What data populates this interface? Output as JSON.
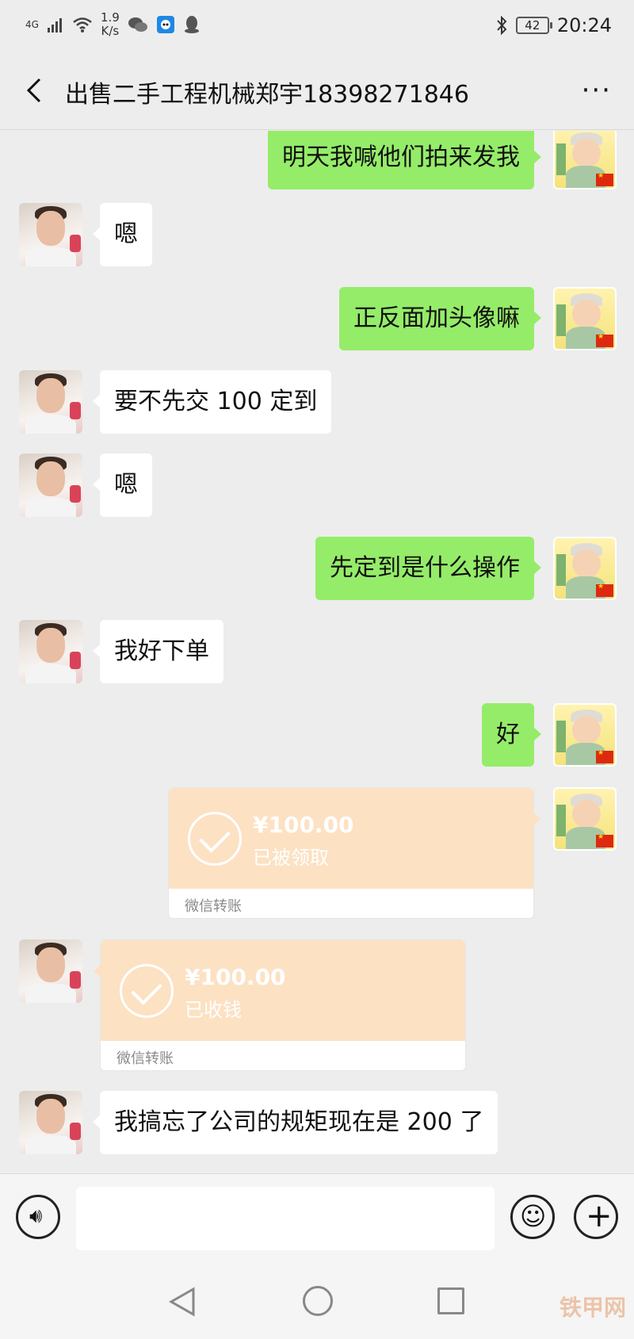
{
  "status_bar": {
    "network": "4G",
    "net_speed_value": "1.9",
    "net_speed_unit": "K/s",
    "battery": "42",
    "time": "20:24",
    "icons": [
      "signal-icon",
      "wifi-icon",
      "wechat-icon",
      "app-icon",
      "qq-icon",
      "bluetooth-icon",
      "battery-icon"
    ]
  },
  "header": {
    "title": "出售二手工程机械郑宇18398271846"
  },
  "messages": [
    {
      "from": "me",
      "type": "text",
      "text": "明天我喊他们拍来发我"
    },
    {
      "from": "other",
      "type": "text",
      "text": "嗯"
    },
    {
      "from": "me",
      "type": "text",
      "text": "正反面加头像嘛"
    },
    {
      "from": "other",
      "type": "text",
      "text": "要不先交 100 定到"
    },
    {
      "from": "other",
      "type": "text",
      "text": "嗯"
    },
    {
      "from": "me",
      "type": "text",
      "text": "先定到是什么操作"
    },
    {
      "from": "other",
      "type": "text",
      "text": "我好下单"
    },
    {
      "from": "me",
      "type": "text",
      "text": "好"
    },
    {
      "from": "me",
      "type": "transfer",
      "amount": "¥100.00",
      "status": "已被领取",
      "label": "微信转账"
    },
    {
      "from": "other",
      "type": "transfer",
      "amount": "¥100.00",
      "status": "已收钱",
      "label": "微信转账"
    },
    {
      "from": "other",
      "type": "text",
      "text": "我搞忘了公司的规矩现在是 200 了"
    }
  ],
  "input_bar": {
    "placeholder": ""
  },
  "watermark": "铁甲网",
  "colors": {
    "background": "#ededed",
    "outgoing_bubble": "#95ec69",
    "incoming_bubble": "#ffffff",
    "transfer_card": "#fce1c3"
  }
}
